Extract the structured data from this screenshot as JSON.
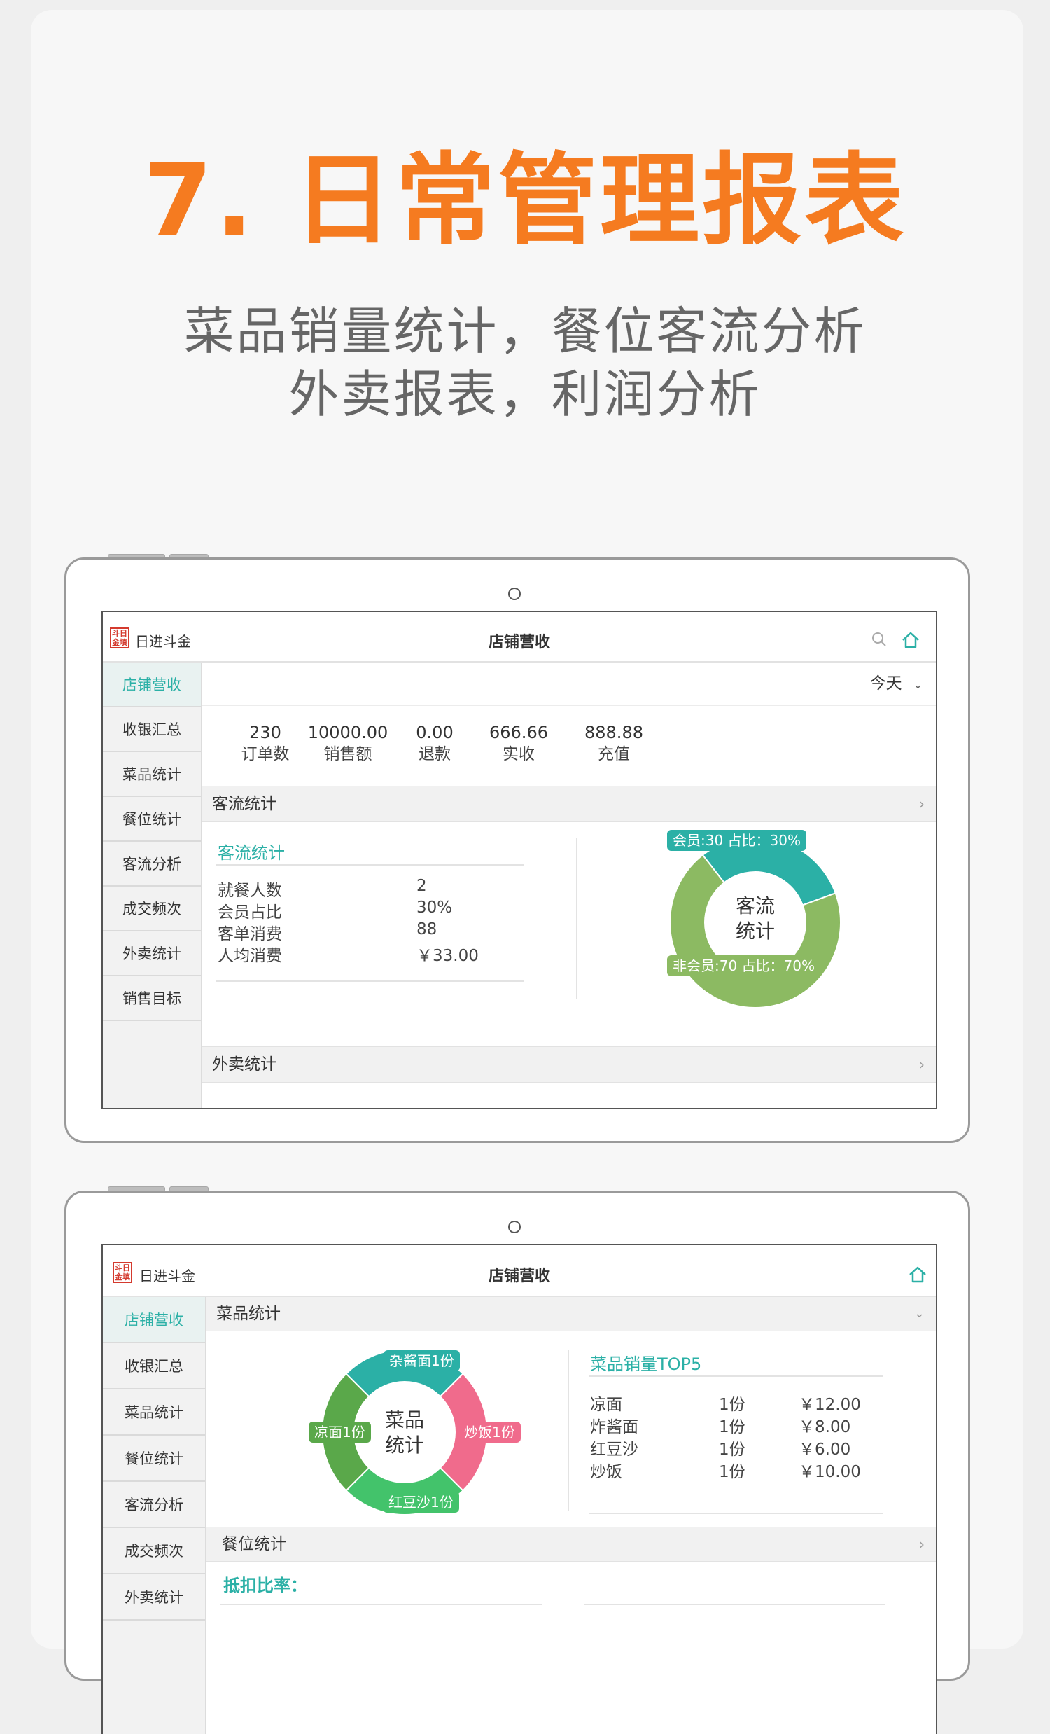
{
  "headline": "7. 日常管理报表",
  "subtitle_line1": "菜品销量统计，餐位客流分析",
  "subtitle_line2": "外卖报表，利润分析",
  "colors": {
    "accent_orange": "#f57b20",
    "teal": "#2bb0a6",
    "green": "#8cba62",
    "pink": "#f06b8c",
    "dark_green": "#5aa84a",
    "med_green": "#43c36b"
  },
  "tablet1": {
    "logo_seal": "斗日金填",
    "logo_text": "日进斗金",
    "title": "店铺营收",
    "icons": [
      "search-icon",
      "home-icon"
    ],
    "sidebar": [
      "店铺营收",
      "收银汇总",
      "菜品统计",
      "餐位统计",
      "客流分析",
      "成交频次",
      "外卖统计",
      "销售目标"
    ],
    "date_filter": "今天",
    "stats": [
      {
        "value": "230",
        "label": "订单数"
      },
      {
        "value": "10000.00",
        "label": "销售额"
      },
      {
        "value": "0.00",
        "label": "退款"
      },
      {
        "value": "666.66",
        "label": "实收"
      },
      {
        "value": "888.88",
        "label": "充值"
      }
    ],
    "section1": "客流统计",
    "panel_title": "客流统计",
    "rows": [
      {
        "label": "就餐人数",
        "value": "2"
      },
      {
        "label": "会员占比",
        "value": "30%"
      },
      {
        "label": "客单消费",
        "value": "88"
      },
      {
        "label": "人均消费",
        "value": "￥33.00"
      }
    ],
    "donut_center": [
      "客流",
      "统计"
    ],
    "donut_labels": [
      "会员:30 占比：30%",
      "非会员:70 占比：70%"
    ],
    "section2": "外卖统计"
  },
  "tablet2": {
    "logo_seal": "斗日金填",
    "logo_text": "日进斗金",
    "title": "店铺营收",
    "icons": [
      "home-icon"
    ],
    "sidebar": [
      "店铺营收",
      "收银汇总",
      "菜品统计",
      "餐位统计",
      "客流分析",
      "成交频次",
      "外卖统计"
    ],
    "section1": "菜品统计",
    "donut_center": [
      "菜品",
      "统计"
    ],
    "donut_labels": [
      "杂酱面1份",
      "炒饭1份",
      "红豆沙1份",
      "凉面1份"
    ],
    "top5_title": "菜品销量TOP5",
    "top5": [
      {
        "name": "凉面",
        "qty": "1份",
        "price": "￥12.00"
      },
      {
        "name": "炸酱面",
        "qty": "1份",
        "price": "￥8.00"
      },
      {
        "name": "红豆沙",
        "qty": "1份",
        "price": "￥6.00"
      },
      {
        "name": "炒饭",
        "qty": "1份",
        "price": "￥10.00"
      }
    ],
    "section2": "餐位统计",
    "deduct_label": "抵扣比率："
  },
  "chart_data": [
    {
      "type": "pie",
      "categories": [
        "会员",
        "非会员"
      ],
      "values": [
        30,
        70
      ]
    },
    {
      "type": "pie",
      "categories": [
        "杂酱面",
        "炒饭",
        "红豆沙",
        "凉面"
      ],
      "values": [
        1,
        1,
        1,
        1
      ]
    }
  ]
}
